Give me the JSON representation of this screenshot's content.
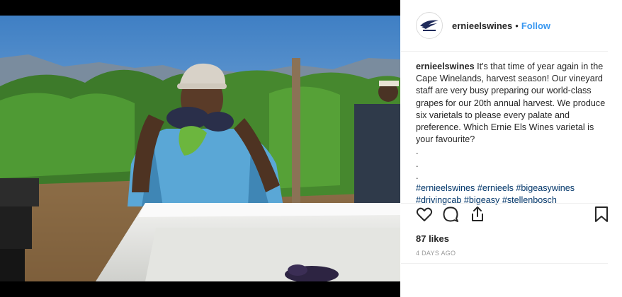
{
  "post": {
    "username": "ernieelswines",
    "follow_label": "Follow",
    "separator": "•",
    "caption_user": "ernieelswines",
    "caption_text": "It's that time of year again in the Cape Winelands, harvest season! Our vineyard staff are very busy preparing our world-class grapes for our 20th annual harvest. We produce six varietals to please every palate and preference. Which Ernie Els Wines varietal is your favourite?",
    "caption_dots": [
      ".",
      ".",
      "."
    ],
    "hashtags": [
      "#ernieelswines",
      "#ernieels",
      "#bigeasywines",
      "#drivingcab",
      "#bigeasy",
      "#stellenbosch"
    ],
    "likes": "87 likes",
    "timestamp": "4 DAYS AGO"
  },
  "icons": {
    "like": "heart-icon",
    "comment": "comment-icon",
    "share": "share-icon",
    "save": "bookmark-icon",
    "avatar": "ernie-els-logo"
  },
  "colors": {
    "follow": "#3897f0",
    "hashtag": "#003569",
    "timestamp": "#999999"
  }
}
